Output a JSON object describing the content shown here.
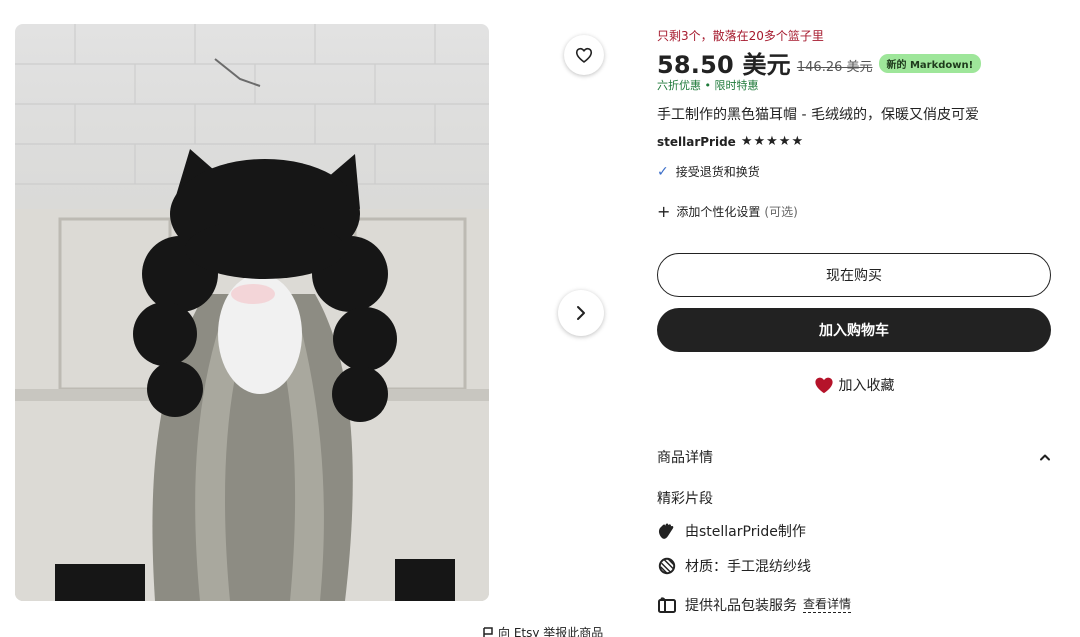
{
  "gallery": {
    "favorite_icon": "heart-outline-icon",
    "next_icon": "chevron-right-icon"
  },
  "report": {
    "icon": "flag-icon",
    "label": "向 Etsy 举报此商品"
  },
  "listing": {
    "stock_note": "只剩3个，散落在20多个篮子里",
    "price": "58.50 美元",
    "original_price": "146.26 美元",
    "badge": "新的 Markdown!",
    "discount": "六折优惠 • 限时特惠",
    "title": "手工制作的黑色猫耳帽 - 毛绒绒的，保暖又俏皮可爱",
    "shop_name": "stellarPride",
    "rating_stars": "★★★★★",
    "returns": "接受退货和换货",
    "personalization": "添加个性化设置",
    "personalization_optional": "(可选)"
  },
  "actions": {
    "buy_now": "现在购买",
    "add_to_cart": "加入购物车",
    "add_to_favorites": "加入收藏"
  },
  "details": {
    "header": "商品详情",
    "highlights_title": "精彩片段",
    "items": [
      {
        "icon": "hand-wave-icon",
        "text": "由stellarPride制作"
      },
      {
        "icon": "yarn-ball-icon",
        "text": "材质：手工混纺纱线"
      },
      {
        "icon": "gift-icon",
        "text": "提供礼品包装服务",
        "link": "查看详情"
      }
    ]
  },
  "colors": {
    "accent_dark": "#222222",
    "stock_red": "#a61a2e",
    "discount_green": "#1f7a3a",
    "badge_green": "#9ee69a",
    "heart_red": "#b5132a",
    "check_blue": "#3b6ec9"
  }
}
